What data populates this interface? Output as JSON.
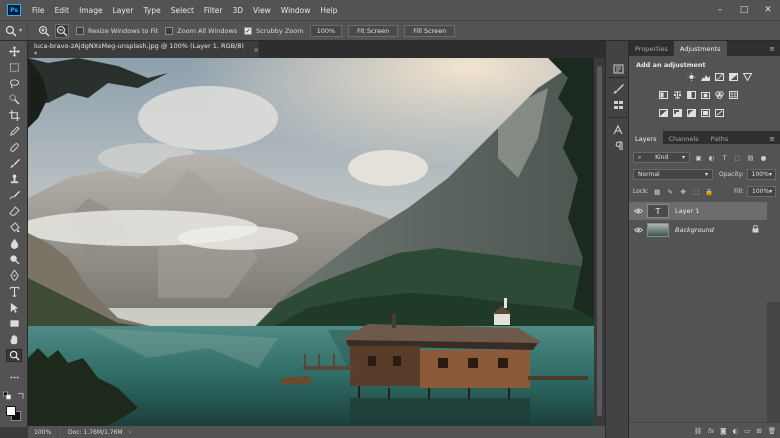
{
  "app": {
    "logo": "Ps"
  },
  "menubar": {
    "items": [
      "File",
      "Edit",
      "Image",
      "Layer",
      "Type",
      "Select",
      "Filter",
      "3D",
      "View",
      "Window",
      "Help"
    ],
    "window_controls": [
      "–",
      "□",
      "✕"
    ]
  },
  "options": {
    "resize_windows_label": "Resize Windows to Fit",
    "resize_windows_checked": false,
    "zoom_all_label": "Zoom All Windows",
    "zoom_all_checked": false,
    "scrubby_label": "Scrubby Zoom",
    "scrubby_checked": true,
    "zoom_value": "100%",
    "fit_screen_label": "Fit Screen",
    "fill_screen_label": "Fill Screen"
  },
  "document": {
    "tab_title": "luca-bravo-zAjdgNXsMeg-unsplash.jpg @ 100% (Layer 1, RGB/8) *",
    "close_glyph": "×"
  },
  "status": {
    "zoom": "100%",
    "doc_info": "Doc: 1.76M/1.76M",
    "arrow": "›"
  },
  "panels": {
    "top_tabs": [
      {
        "label": "Properties",
        "active": false
      },
      {
        "label": "Adjustments",
        "active": true
      }
    ],
    "menu_glyph": "≡",
    "adjustments_title": "Add an adjustment",
    "layer_tabs": [
      {
        "label": "Layers",
        "active": true
      },
      {
        "label": "Channels",
        "active": false
      },
      {
        "label": "Paths",
        "active": false
      }
    ],
    "filter_kind": "Kind",
    "blend_mode": "Normal",
    "opacity_label": "Opacity:",
    "opacity_value": "100%",
    "lock_label": "Lock:",
    "fill_label": "Fill:",
    "fill_value": "100%",
    "layers": [
      {
        "name": "Layer 1",
        "type": "text",
        "selected": true,
        "visible": true
      },
      {
        "name": "Background",
        "type": "image",
        "selected": false,
        "visible": true,
        "locked": true
      }
    ],
    "footer_icons": [
      "link-icon",
      "fx-icon",
      "mask-icon",
      "adjustment-icon",
      "folder-icon",
      "new-layer-icon",
      "trash-icon"
    ]
  }
}
